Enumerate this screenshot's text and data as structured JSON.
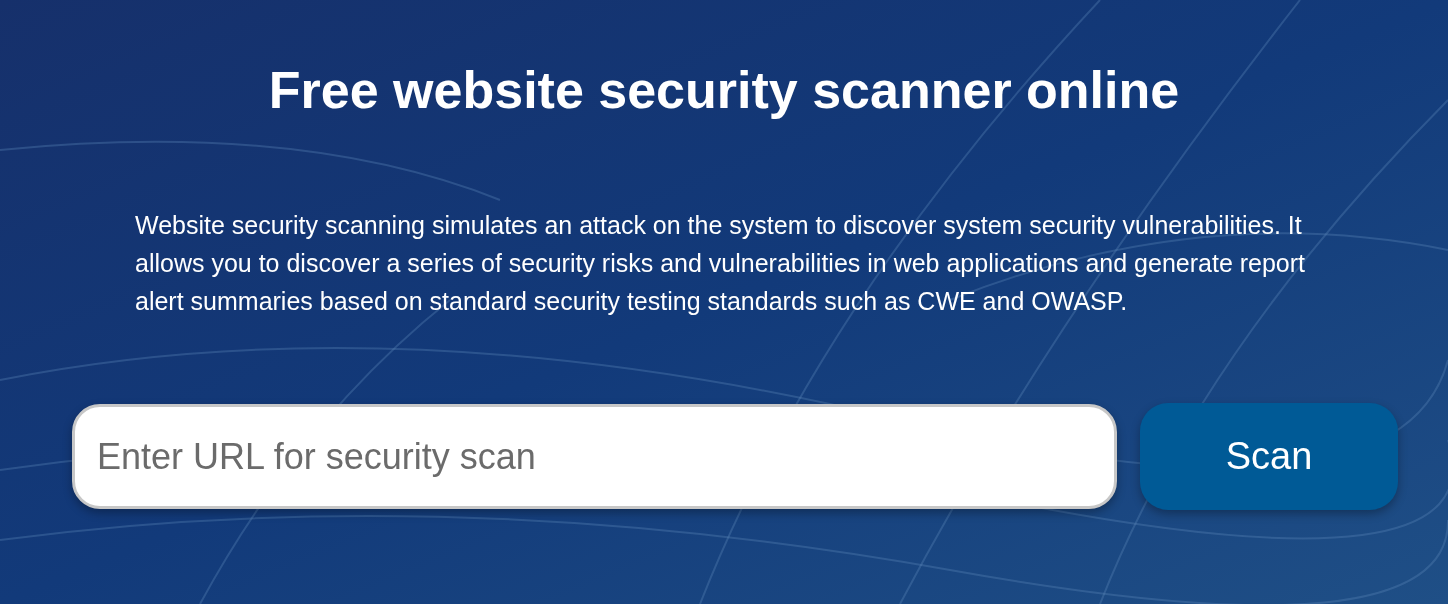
{
  "heading": "Free website security scanner online",
  "description": "Website security scanning simulates an attack on the system to discover system security vulnerabilities. It allows you to discover a series of security risks and vulnerabilities in web applications and generate report alert summaries based on standard security testing standards such as CWE and OWASP.",
  "search": {
    "placeholder": "Enter URL for security scan"
  },
  "scan_button": {
    "label": "Scan"
  }
}
